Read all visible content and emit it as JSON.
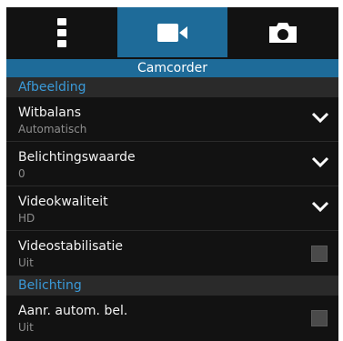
{
  "tabs": [
    {
      "icon": "more-vertical-icon",
      "active": false
    },
    {
      "icon": "video-camera-icon",
      "active": true
    },
    {
      "icon": "camera-icon",
      "active": false
    }
  ],
  "mode_label": "Camcorder",
  "sections": [
    {
      "header": "Afbeelding",
      "rows": [
        {
          "title": "Witbalans",
          "value": "Automatisch",
          "control": "dropdown"
        },
        {
          "title": "Belichtingswaarde",
          "value": "0",
          "control": "dropdown"
        },
        {
          "title": "Videokwaliteit",
          "value": "HD",
          "control": "dropdown"
        },
        {
          "title": "Videostabilisatie",
          "value": "Uit",
          "control": "checkbox",
          "checked": false
        }
      ]
    },
    {
      "header": "Belichting",
      "rows": [
        {
          "title": "Aanr. autom. bel.",
          "value": "Uit",
          "control": "checkbox",
          "checked": false
        }
      ]
    }
  ],
  "colors": {
    "accent": "#1e6b99",
    "section_text": "#3a9ad9",
    "background": "#121212"
  }
}
